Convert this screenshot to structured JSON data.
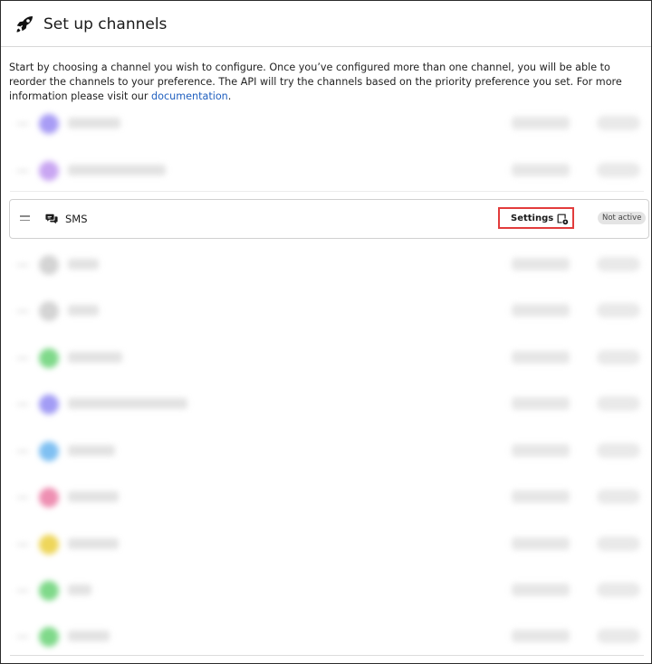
{
  "header": {
    "title": "Set up channels",
    "icon": "rocket-icon"
  },
  "intro": {
    "text": "Start by choosing a channel you wish to configure. Once you’ve configured more than one channel, you will be able to reorder the channels to your preference. The API will try the channels based on the priority preference you set. For more information please visit our ",
    "link_text": "documentation",
    "suffix": "."
  },
  "channels": {
    "sms": {
      "label": "SMS",
      "settings_label": "Settings",
      "status": "Not active",
      "icon": "chat-bubbles-icon",
      "settings_icon": "settings-gear-icon"
    },
    "blurred_row_colors": [
      "#a89cf5",
      "#c9a6f2",
      "#d4d4d4",
      "#d4d4d4",
      "#7fd98a",
      "#a29cf5",
      "#7fc0f2",
      "#ee8fb2",
      "#eed65a",
      "#7fd98a",
      "#7fd98a"
    ]
  },
  "colors": {
    "highlight": "#e23c3c",
    "link": "#1f5fbf",
    "badge_bg": "#e4e4e4"
  }
}
